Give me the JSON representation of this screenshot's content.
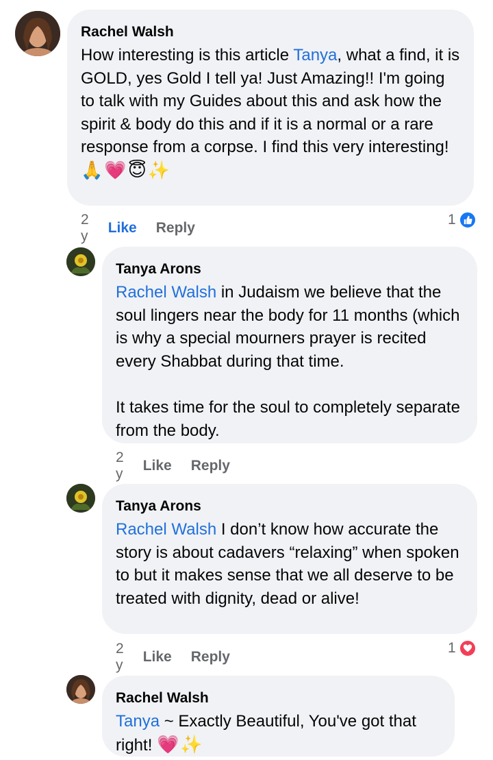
{
  "comments": [
    {
      "author": "Rachel Walsh",
      "mention": "Tanya",
      "text_before": "How interesting is this article ",
      "text_after": ", what a find, it is GOLD, yes Gold I tell ya! Just Amazing!! I'm going to talk with my Guides about this and ask how the spirit & body do this and if it is a normal or a rare response from a corpse. I find this very interesting!",
      "emojis": "🙏💗😇✨",
      "time": "2 y",
      "like_label": "Like",
      "reply_label": "Reply",
      "reaction_count": "1",
      "reaction_icon": "like-icon",
      "reaction_color": "#1877f2"
    },
    {
      "author": "Tanya Arons",
      "mention": "Rachel Walsh",
      "text_after": " in Judaism we believe that the soul lingers near the body for 11 months (which is why a special mourners prayer is recited every Shabbat during that time.\n\nIt takes time for the soul to completely separate from the body.",
      "time": "2 y",
      "like_label": "Like",
      "reply_label": "Reply"
    },
    {
      "author": "Tanya Arons",
      "mention": "Rachel Walsh",
      "text_after": " I don’t know how accurate the story is about cadavers “relaxing” when spoken to but it makes sense that we all deserve to be treated with dignity, dead or alive!",
      "time": "2 y",
      "like_label": "Like",
      "reply_label": "Reply",
      "reaction_count": "1",
      "reaction_icon": "love-icon",
      "reaction_color": "#f33e58"
    },
    {
      "author": "Rachel Walsh",
      "mention": "Tanya",
      "text_after": " ~ Exactly Beautiful, You've got that right! ",
      "emojis": "💗✨"
    }
  ],
  "colors": {
    "bubble": "#f0f2f5",
    "mention": "#216fdb",
    "meta": "#65676b",
    "like_blue": "#1877f2"
  }
}
